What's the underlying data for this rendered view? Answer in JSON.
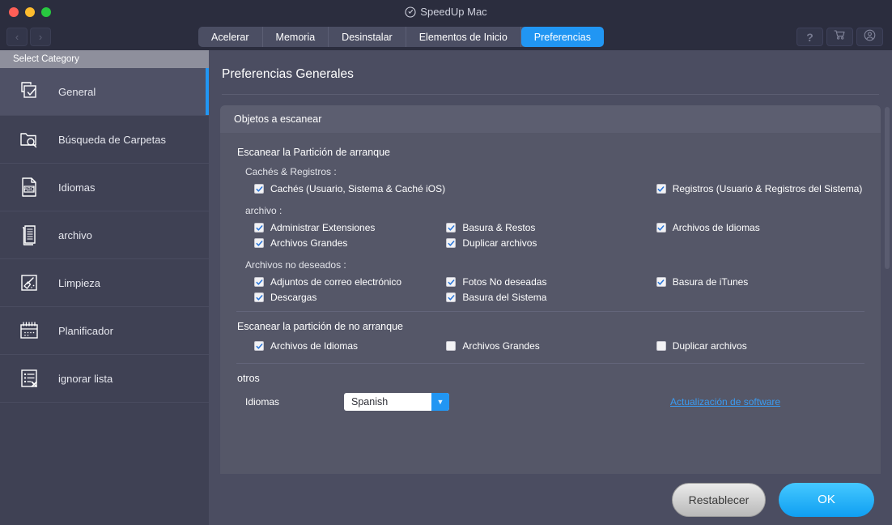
{
  "window": {
    "title": "SpeedUp Mac",
    "title_icon": "speedometer-icon",
    "traffic_lights": [
      "close",
      "minimize",
      "zoom"
    ]
  },
  "toolbar": {
    "back_glyph": "‹",
    "forward_glyph": "›",
    "tabs": [
      {
        "label": "Acelerar",
        "active": false
      },
      {
        "label": "Memoria",
        "active": false
      },
      {
        "label": "Desinstalar",
        "active": false
      },
      {
        "label": "Elementos de Inicio",
        "active": false
      },
      {
        "label": "Preferencias",
        "active": true
      }
    ],
    "right_buttons": [
      {
        "name": "help-button",
        "glyph": "?"
      },
      {
        "name": "cart-button",
        "glyph": "cart-icon"
      },
      {
        "name": "account-button",
        "glyph": "user-icon"
      }
    ]
  },
  "sidebar": {
    "header": "Select Category",
    "items": [
      {
        "label": "General",
        "icon": "copy-check-icon",
        "selected": true
      },
      {
        "label": "Búsqueda de Carpetas",
        "icon": "folder-search-icon",
        "selected": false
      },
      {
        "label": "Idiomas",
        "icon": "abc-document-icon",
        "selected": false
      },
      {
        "label": "archivo",
        "icon": "documents-icon",
        "selected": false
      },
      {
        "label": "Limpieza",
        "icon": "broom-icon",
        "selected": false
      },
      {
        "label": "Planificador",
        "icon": "calendar-icon",
        "selected": false
      },
      {
        "label": "ignorar lista",
        "icon": "list-x-icon",
        "selected": false
      }
    ]
  },
  "main": {
    "page_title": "Preferencias Generales",
    "panel_header": "Objetos a escanear",
    "boot_section": {
      "title": "Escanear la Partición de arranque",
      "groups": [
        {
          "subtitle": "Cachés & Registros :",
          "rows": [
            [
              {
                "label": "Cachés (Usuario, Sistema & Caché iOS)",
                "checked": true
              },
              {
                "label": "",
                "checked": null
              },
              {
                "label": "Registros  (Usuario & Registros del Sistema)",
                "checked": true
              }
            ]
          ]
        },
        {
          "subtitle": "archivo :",
          "rows": [
            [
              {
                "label": "Administrar Extensiones",
                "checked": true
              },
              {
                "label": "Basura & Restos",
                "checked": true
              },
              {
                "label": "Archivos de Idiomas",
                "checked": true
              }
            ],
            [
              {
                "label": "Archivos Grandes",
                "checked": true
              },
              {
                "label": "Duplicar archivos",
                "checked": true
              },
              {
                "label": "",
                "checked": null
              }
            ]
          ]
        },
        {
          "subtitle": "Archivos no deseados :",
          "rows": [
            [
              {
                "label": "Adjuntos de correo electrónico",
                "checked": true
              },
              {
                "label": "Fotos No deseadas",
                "checked": true
              },
              {
                "label": "Basura de iTunes",
                "checked": true
              }
            ],
            [
              {
                "label": "Descargas",
                "checked": true
              },
              {
                "label": "Basura del Sistema",
                "checked": true
              },
              {
                "label": "",
                "checked": null
              }
            ]
          ]
        }
      ]
    },
    "nonboot_section": {
      "title": "Escanear la partición de no arranque",
      "rows": [
        [
          {
            "label": "Archivos de Idiomas",
            "checked": true
          },
          {
            "label": "Archivos Grandes",
            "checked": false
          },
          {
            "label": "Duplicar archivos",
            "checked": false
          }
        ]
      ]
    },
    "others_section": {
      "title": "otros",
      "language_label": "Idiomas",
      "language_value": "Spanish",
      "language_options": [
        "Spanish"
      ],
      "update_link": "Actualización de software"
    }
  },
  "footer": {
    "reset_label": "Restablecer",
    "ok_label": "OK"
  },
  "colors": {
    "accent": "#2196f3",
    "window_bg": "#2b2d3e",
    "sidebar_bg": "#3f4154",
    "main_bg": "#4b4d61",
    "panel_bg": "#555768",
    "link": "#3b9bf0"
  }
}
